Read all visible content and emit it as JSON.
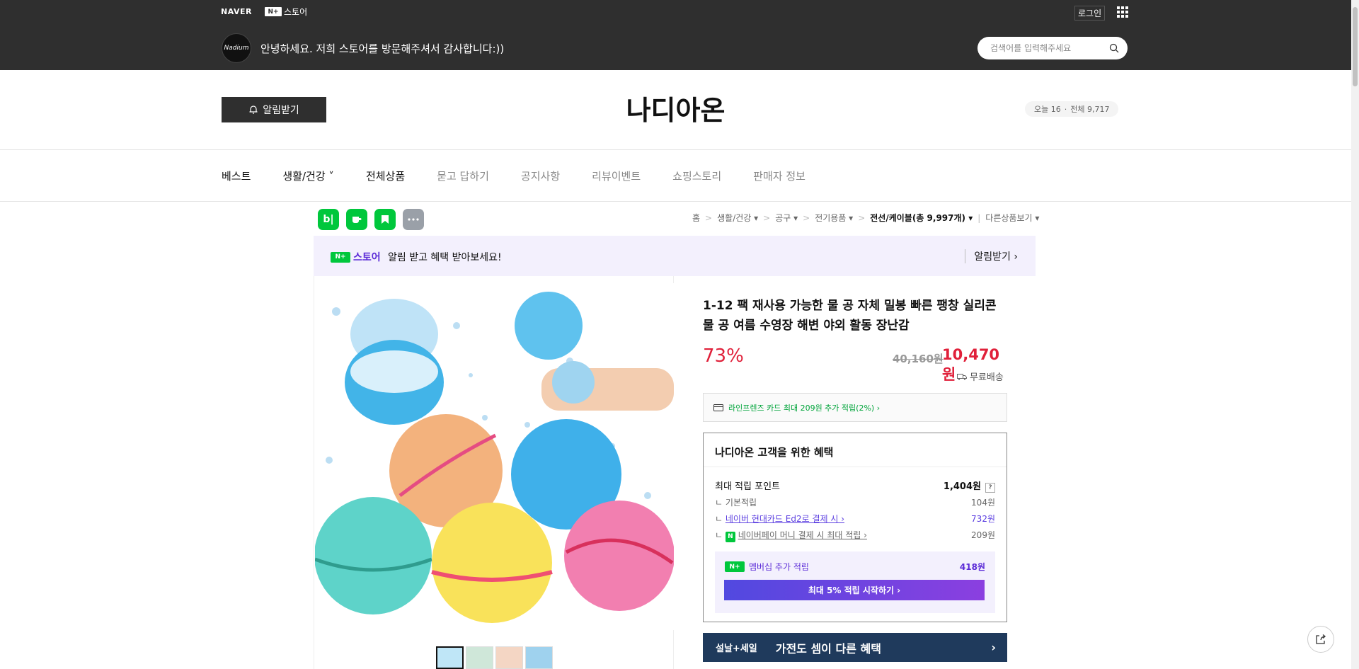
{
  "topbar": {
    "naver": "NAVER",
    "store_badge": "N+",
    "store_label": "스토어",
    "login": "로그인",
    "welcome": "안녕하세요. 저희 스토어를 방문해주셔서 감사합니다:))",
    "avatar_text": "Nadium",
    "search_placeholder": "검색어를 입력해주세요"
  },
  "header": {
    "notify_button": "알림받기",
    "store_name": "나디아온",
    "today_label": "오늘 16",
    "total_label": "전체 9,717"
  },
  "nav": {
    "items": [
      {
        "label": "베스트"
      },
      {
        "label": "생활/건강 ˅"
      },
      {
        "label": "전체상품"
      },
      {
        "label": "묻고 답하기"
      },
      {
        "label": "공지사항"
      },
      {
        "label": "리뷰이벤트"
      },
      {
        "label": "쇼핑스토리"
      },
      {
        "label": "판매자 정보"
      }
    ]
  },
  "breadcrumb": {
    "home": "홈",
    "c1": "생활/건강 ▾",
    "c2": "공구 ▾",
    "c3": "전기용품 ▾",
    "c4": "전선/케이블(총 9,997개) ▾",
    "c5": "다른상품보기 ▾"
  },
  "sns": {
    "blog": "b|"
  },
  "promo": {
    "store_label": "스토어",
    "text": "알림 받고 혜택 받아보세요!",
    "link": "알림받기 ›"
  },
  "product": {
    "title": "1-12 팩 재사용 가능한 물 공 자체 밀봉 빠른 팽창 실리콘 물 공 여름 수영장 해변 야외 활동 장난감",
    "discount": "73%",
    "original_price": "40,160원",
    "price": "10,470원",
    "shipping": "무료배송",
    "card_benefit": "라인프렌즈 카드 최대 209원 추가 적립(2%) ›"
  },
  "benefit": {
    "title": "나디아온 고객을 위한 혜택",
    "max_label": "최대 적립 포인트",
    "max_value": "1,404원",
    "q": "?",
    "base_label": "기본적립",
    "base_value": "104원",
    "card_label": "네이버 현대카드 Ed2로 결제 시 ›",
    "card_value": "732원",
    "pay_label": "네이버페이 머니 결제 시 최대 적립 ›",
    "pay_value": "209원",
    "member_label": "멤버십 추가 적립",
    "member_value": "418원",
    "member_button": "최대 5% 적립 시작하기 ›"
  },
  "banner": {
    "tag": "설날+세일",
    "text": "가전도 셈이 다른 혜택",
    "arrow": "›"
  },
  "colors": {
    "topbar": "#2f2f2f",
    "accent_red": "#e0203a",
    "naver_green": "#00c73c",
    "purple": "#5b2bd7",
    "banner": "#1f3a5c"
  }
}
